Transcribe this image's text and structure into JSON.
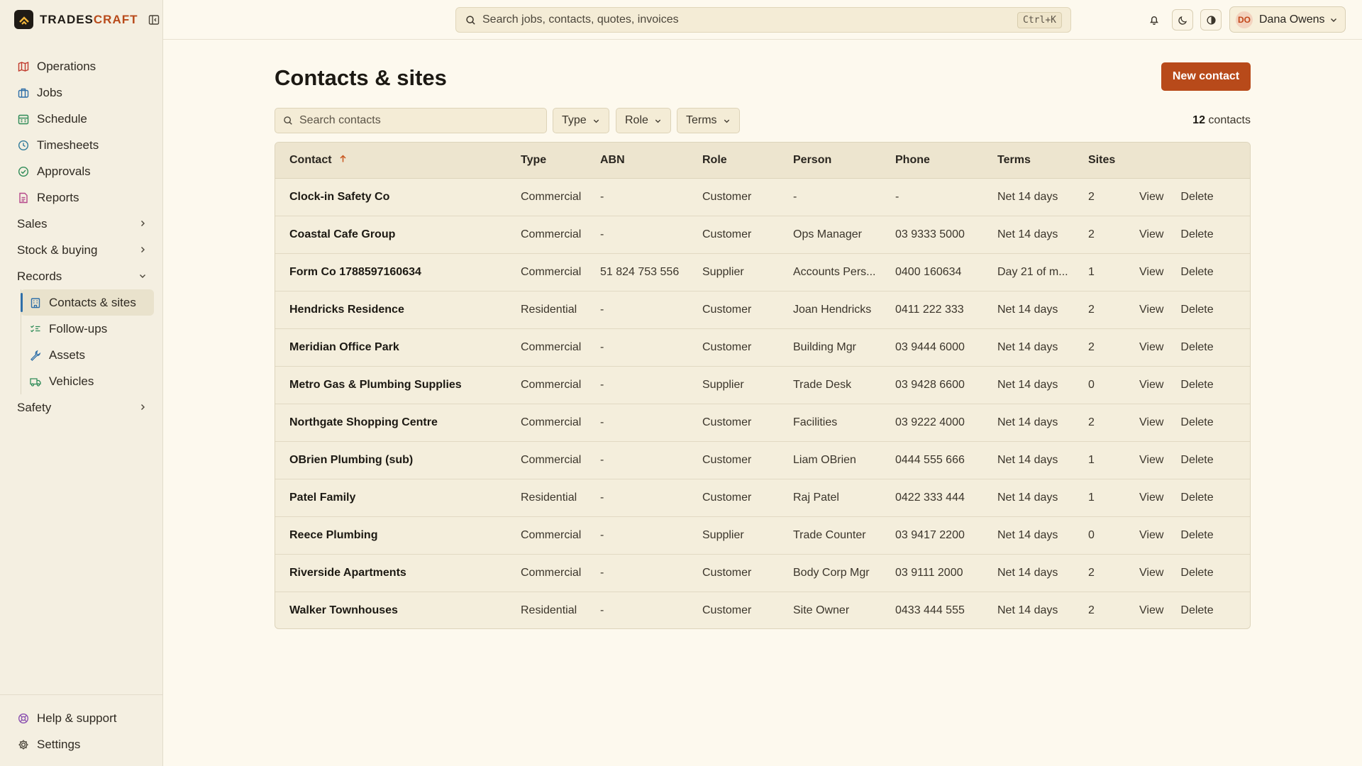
{
  "brand": {
    "name_a": "TRADES",
    "name_b": "CRAFT"
  },
  "sidebar": {
    "items": [
      {
        "label": "Operations",
        "icon": "map-icon",
        "color": "#c0392b"
      },
      {
        "label": "Jobs",
        "icon": "briefcase-icon",
        "color": "#2f6fa8"
      },
      {
        "label": "Schedule",
        "icon": "calendar-icon",
        "color": "#2e8b57"
      },
      {
        "label": "Timesheets",
        "icon": "clock-icon",
        "color": "#2f7a9a"
      },
      {
        "label": "Approvals",
        "icon": "check-circle-icon",
        "color": "#2e8b57"
      },
      {
        "label": "Reports",
        "icon": "document-icon",
        "color": "#b5478a"
      }
    ],
    "groups": {
      "sales": "Sales",
      "stock": "Stock & buying",
      "records": "Records",
      "safety": "Safety"
    },
    "records_items": [
      {
        "label": "Contacts & sites",
        "icon": "building-icon",
        "color": "#2f6fa8"
      },
      {
        "label": "Follow-ups",
        "icon": "list-check-icon",
        "color": "#2e8b57"
      },
      {
        "label": "Assets",
        "icon": "wrench-icon",
        "color": "#2f6fa8"
      },
      {
        "label": "Vehicles",
        "icon": "truck-icon",
        "color": "#2e8b57"
      }
    ],
    "bottom": {
      "help": "Help & support",
      "settings": "Settings"
    }
  },
  "header": {
    "search_placeholder": "Search jobs, contacts, quotes, invoices",
    "shortcut": "Ctrl+K",
    "user_initials": "DO",
    "user_name": "Dana Owens"
  },
  "main": {
    "title": "Contacts & sites",
    "new_button": "New contact",
    "search_placeholder": "Search contacts",
    "filters": [
      "Type",
      "Role",
      "Terms"
    ],
    "count_num": "12",
    "count_label": " contacts"
  },
  "table": {
    "columns": [
      "Contact",
      "Type",
      "ABN",
      "Role",
      "Person",
      "Phone",
      "Terms",
      "Sites"
    ],
    "view_label": "View",
    "delete_label": "Delete",
    "rows": [
      [
        "Clock-in Safety Co",
        "Commercial",
        "-",
        "Customer",
        "-",
        "-",
        "Net 14 days",
        "2"
      ],
      [
        "Coastal Cafe Group",
        "Commercial",
        "-",
        "Customer",
        "Ops Manager",
        "03 9333 5000",
        "Net 14 days",
        "2"
      ],
      [
        "Form Co 1788597160634",
        "Commercial",
        "51 824 753 556",
        "Supplier",
        "Accounts Pers...",
        "0400 160634",
        "Day 21 of m...",
        "1"
      ],
      [
        "Hendricks Residence",
        "Residential",
        "-",
        "Customer",
        "Joan Hendricks",
        "0411 222 333",
        "Net 14 days",
        "2"
      ],
      [
        "Meridian Office Park",
        "Commercial",
        "-",
        "Customer",
        "Building Mgr",
        "03 9444 6000",
        "Net 14 days",
        "2"
      ],
      [
        "Metro Gas & Plumbing Supplies",
        "Commercial",
        "-",
        "Supplier",
        "Trade Desk",
        "03 9428 6600",
        "Net 14 days",
        "0"
      ],
      [
        "Northgate Shopping Centre",
        "Commercial",
        "-",
        "Customer",
        "Facilities",
        "03 9222 4000",
        "Net 14 days",
        "2"
      ],
      [
        "OBrien Plumbing (sub)",
        "Commercial",
        "-",
        "Customer",
        "Liam OBrien",
        "0444 555 666",
        "Net 14 days",
        "1"
      ],
      [
        "Patel Family",
        "Residential",
        "-",
        "Customer",
        "Raj Patel",
        "0422 333 444",
        "Net 14 days",
        "1"
      ],
      [
        "Reece Plumbing",
        "Commercial",
        "-",
        "Supplier",
        "Trade Counter",
        "03 9417 2200",
        "Net 14 days",
        "0"
      ],
      [
        "Riverside Apartments",
        "Commercial",
        "-",
        "Customer",
        "Body Corp Mgr",
        "03 9111 2000",
        "Net 14 days",
        "2"
      ],
      [
        "Walker Townhouses",
        "Residential",
        "-",
        "Customer",
        "Site Owner",
        "0433 444 555",
        "Net 14 days",
        "2"
      ]
    ]
  },
  "colors": {
    "accent": "#b84a1a",
    "active_indicator": "#2f6fa8"
  }
}
